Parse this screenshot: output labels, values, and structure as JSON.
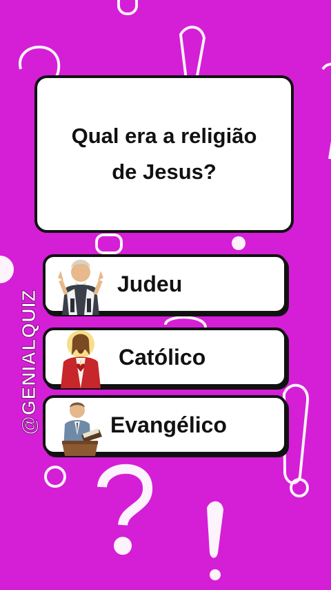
{
  "background_color": "#d41fd6",
  "question": {
    "line1": "Qual era a religião",
    "line2": "de Jesus?"
  },
  "answers": [
    {
      "label": "Judeu",
      "icon": "praying-man-icon"
    },
    {
      "label": "Católico",
      "icon": "sacred-heart-jesus-icon"
    },
    {
      "label": "Evangélico",
      "icon": "preacher-at-pulpit-icon"
    }
  ],
  "watermark": "@GENIALQUIZ"
}
